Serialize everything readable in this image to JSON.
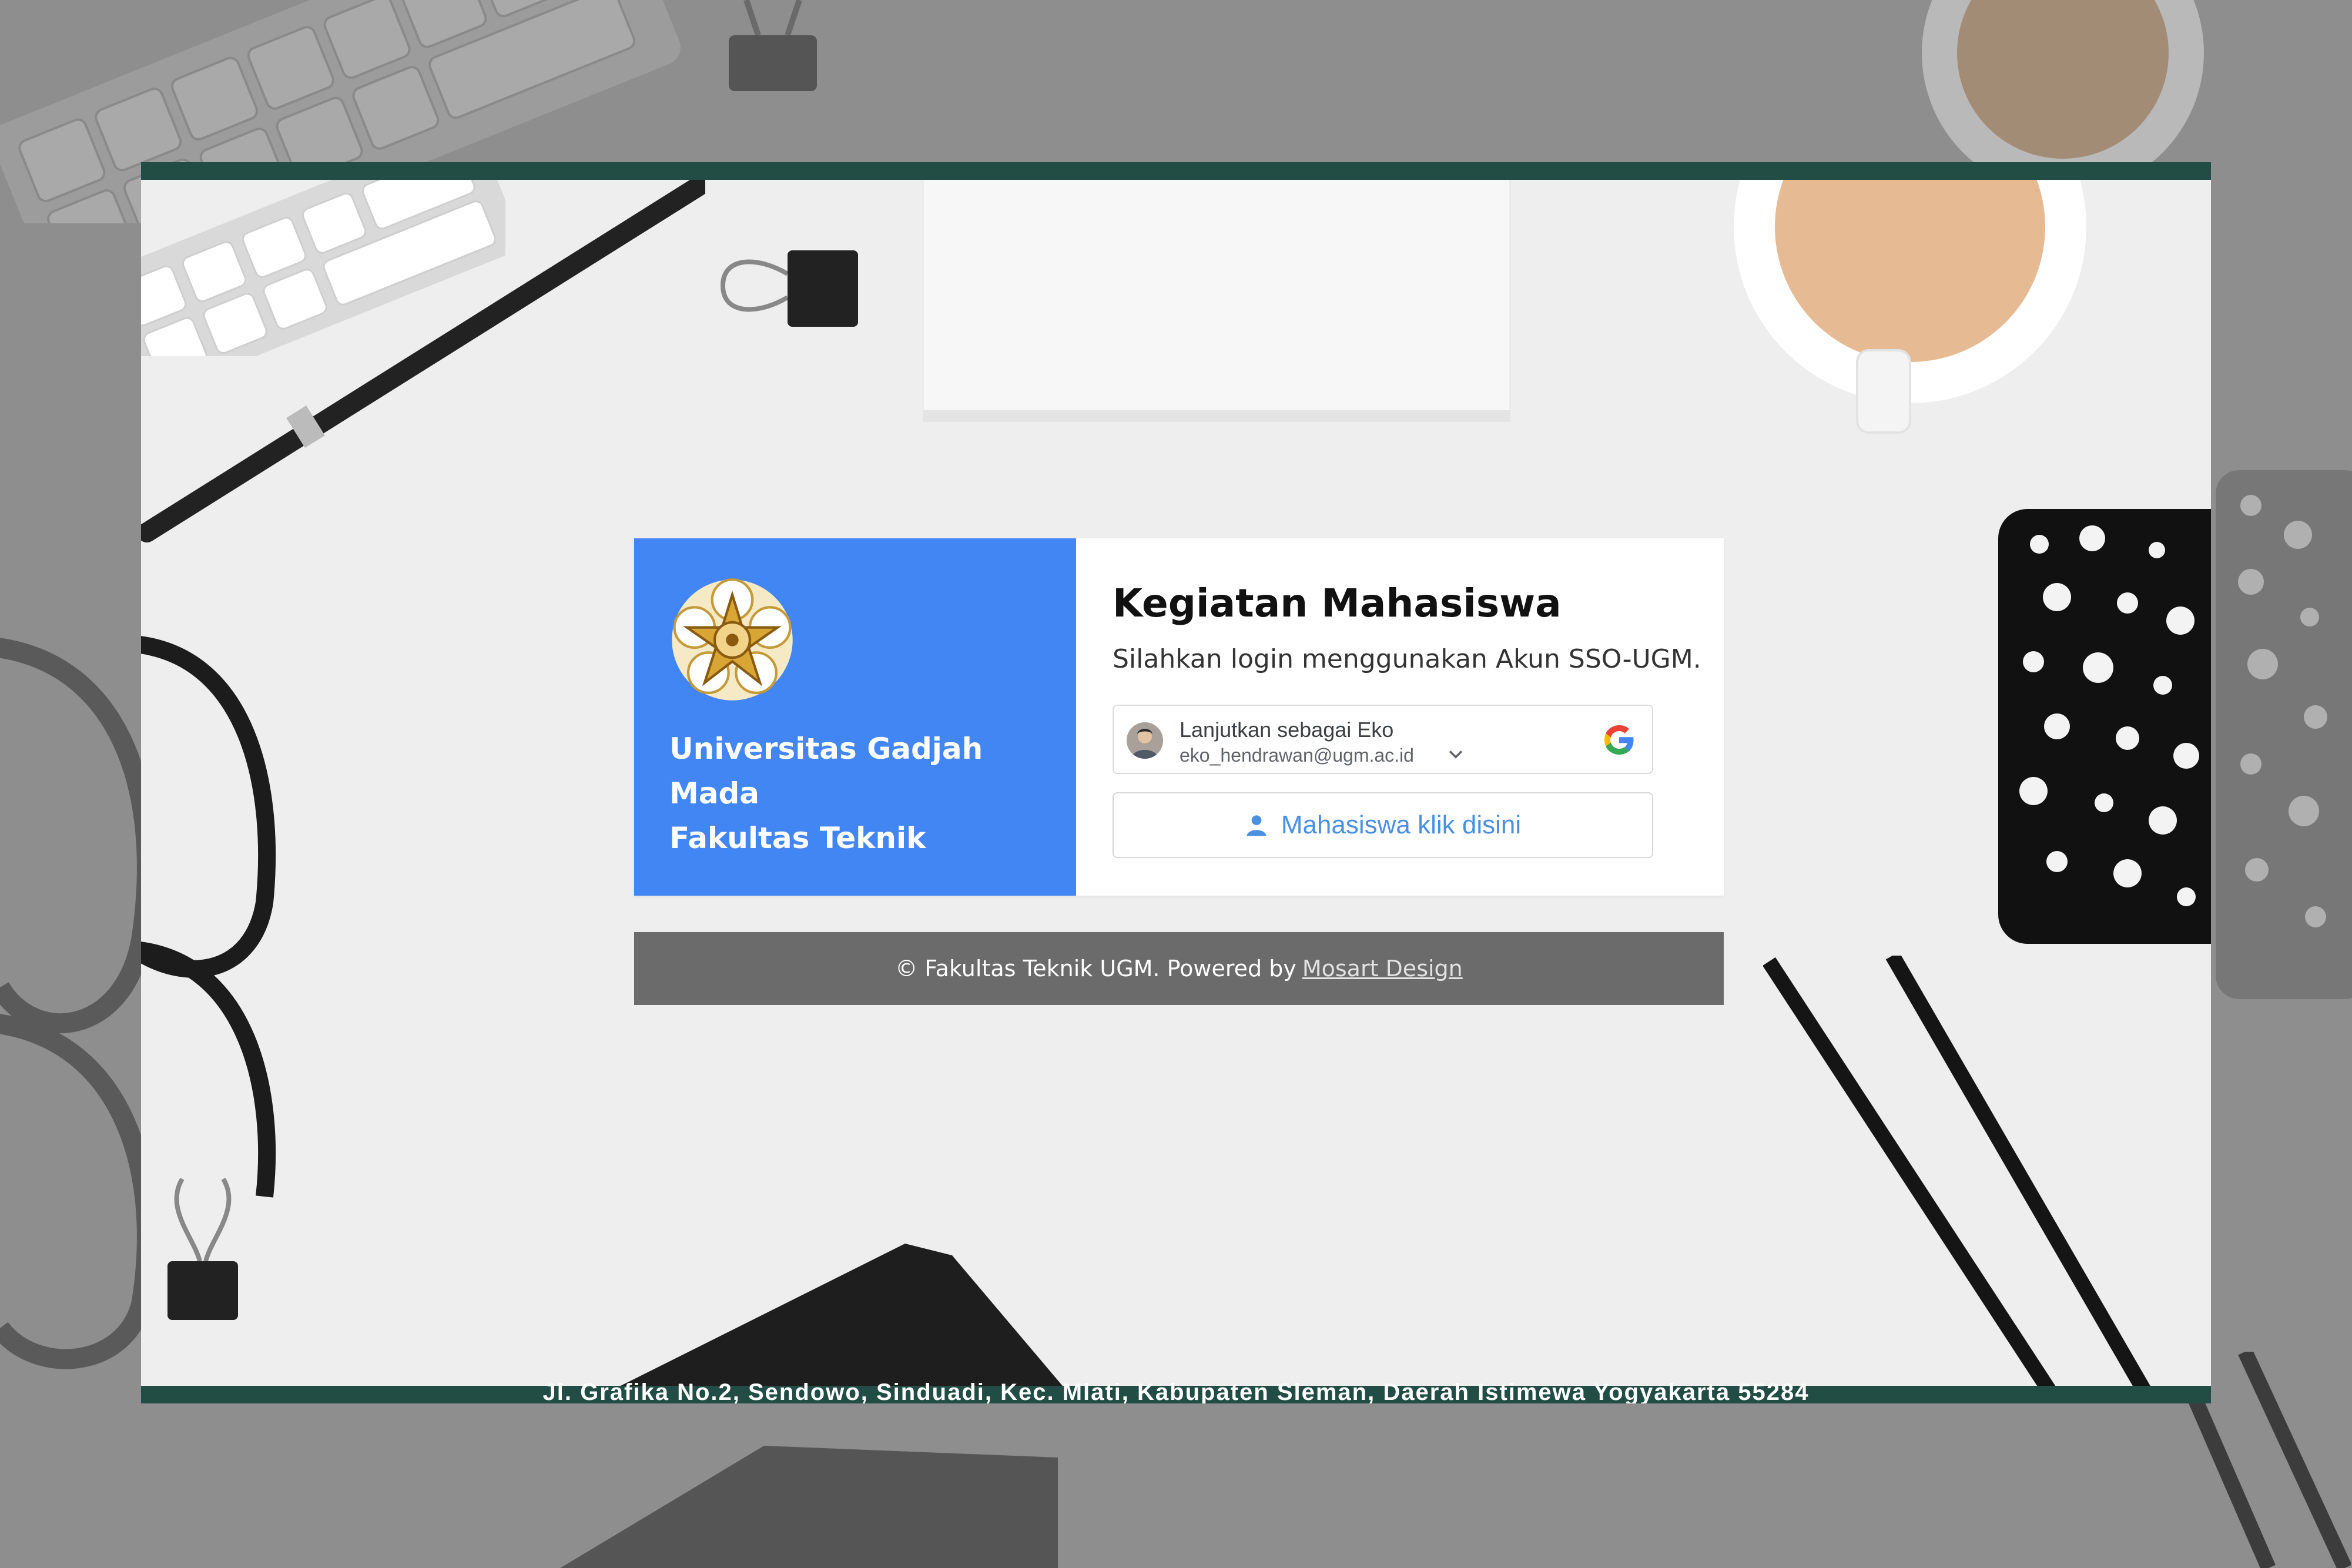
{
  "institution": {
    "name_line1": "Universitas Gadjah Mada",
    "name_line2": "Fakultas Teknik"
  },
  "login": {
    "title": "Kegiatan Mahasiswa",
    "subtitle": "Silahkan login menggunakan Akun SSO-UGM.",
    "google_account": {
      "label": "Lanjutkan sebagai Eko",
      "email": "eko_hendrawan@ugm.ac.id",
      "icon": "google-icon"
    },
    "student_button": {
      "label": "Mahasiswa klik disini",
      "icon": "user-icon"
    }
  },
  "footer": {
    "text": "© Fakultas Teknik UGM. Powered by",
    "link_label": "Mosart Design"
  },
  "address": "Jl. Grafika No.2, Sendowo, Sinduadi, Kec. Mlati, Kabupaten Sleman, Daerah Istimewa Yogyakarta 55284",
  "colors": {
    "accent_blue": "#4286f4",
    "frame_green": "#224d45",
    "footer_gray": "#6b6b6b",
    "link_blue": "#4a90e2"
  }
}
